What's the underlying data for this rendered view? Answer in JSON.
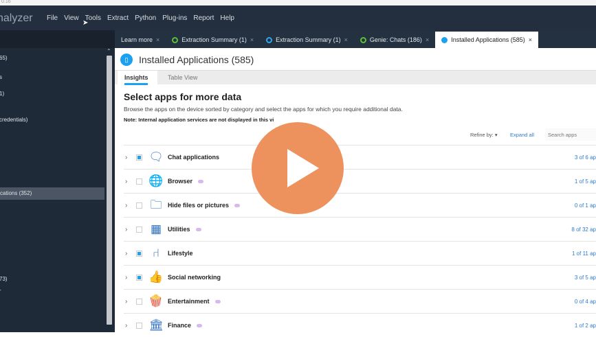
{
  "window": {
    "version_fragment": "0.16"
  },
  "menubar": {
    "app_name": "nalyzer",
    "items": [
      "File",
      "View",
      "Tools",
      "Extract",
      "Python",
      "Plug-ins",
      "Report",
      "Help"
    ]
  },
  "sidebar": {
    "items": [
      {
        "label": "65)",
        "selected": false
      },
      {
        "label": "s",
        "selected": false
      },
      {
        "label": "1)",
        "selected": false
      },
      {
        "label": "credentials)",
        "selected": false
      },
      {
        "label": "cations (352)",
        "selected": true
      },
      {
        "label": "73)",
        "selected": false
      },
      {
        "label": "-",
        "selected": false
      }
    ]
  },
  "tabs": [
    {
      "label": "Learn more",
      "status": "none"
    },
    {
      "label": "Extraction Summary (1)",
      "status": "green-ring"
    },
    {
      "label": "Extraction Summary (1)",
      "status": "blue-ring"
    },
    {
      "label": "Genie: Chats (186)",
      "status": "green-ring"
    },
    {
      "label": "Installed Applications (585)",
      "status": "blue-dot",
      "active": true
    }
  ],
  "page": {
    "title": "Installed Applications (585)",
    "subtabs": [
      "Insights",
      "Table View"
    ],
    "heading": "Select apps for more data",
    "description": "Browse the apps on the device sorted by category and select the apps for which you require additional data.",
    "note": "Note: Internal application services are not displayed in this vi",
    "refine_label": "Refine by: ▾",
    "expand_all": "Expand all",
    "search_placeholder": "Search apps"
  },
  "categories": [
    {
      "name": "Chat applications",
      "checked": true,
      "icon": "chat-icon",
      "glyph": "🗨",
      "count": "3 of 6 ap"
    },
    {
      "name": "Browser",
      "checked": false,
      "icon": "browser-globe-icon",
      "glyph": "🌐",
      "count": "1 of 5 ap"
    },
    {
      "name": "Hide files or pictures",
      "checked": false,
      "icon": "folder-icon",
      "glyph": "🗀",
      "count": "0 of 1 ap"
    },
    {
      "name": "Utilities",
      "checked": false,
      "icon": "calculator-icon",
      "glyph": "▦",
      "count": "8 of 32 ap"
    },
    {
      "name": "Lifestyle",
      "checked": true,
      "icon": "chair-icon",
      "glyph": "⑁",
      "count": "1 of 11 ap"
    },
    {
      "name": "Social networking",
      "checked": true,
      "icon": "thumbs-up-icon",
      "glyph": "👍",
      "count": "3 of 5 ap"
    },
    {
      "name": "Entertainment",
      "checked": false,
      "icon": "popcorn-icon",
      "glyph": "🍿",
      "count": "0 of 4 ap"
    },
    {
      "name": "Finance",
      "checked": false,
      "icon": "bank-icon",
      "glyph": "🏛",
      "count": "1 of 2 ap"
    }
  ],
  "colors": {
    "accent": "#1ea0f0",
    "play": "#ed8d57",
    "menubar": "#232f3e"
  }
}
